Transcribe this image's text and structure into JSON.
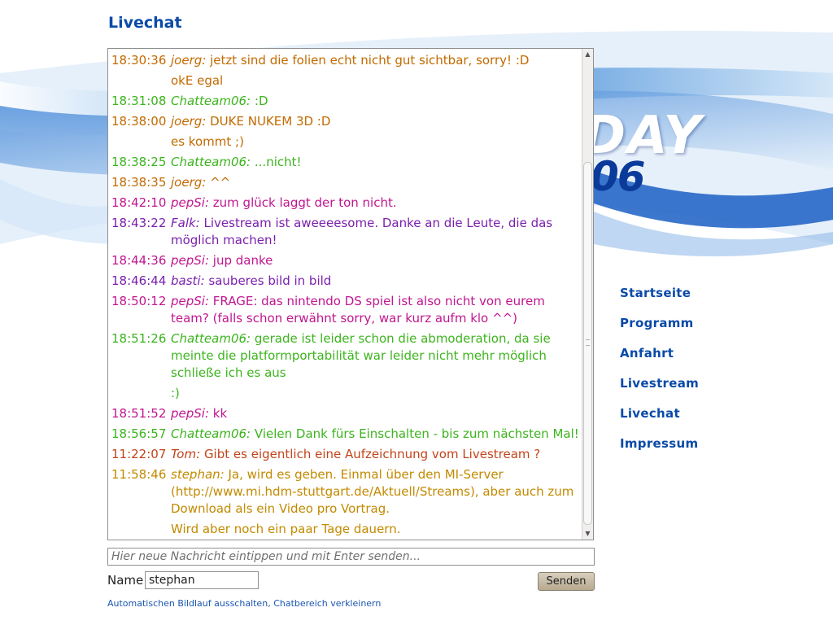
{
  "page": {
    "title": "Livechat"
  },
  "logo": {
    "text": "DAY",
    "year": "06"
  },
  "chat": {
    "messages": [
      {
        "time": "18:30:36",
        "nick": "joerg:",
        "text": "jetzt sind die folien echt nicht gut sichtbar, sorry! :D",
        "color": "#c26a00"
      },
      {
        "time": "",
        "nick": "",
        "text": "okE egal",
        "color": "#c26a00"
      },
      {
        "time": "18:31:08",
        "nick": "Chatteam06:",
        "text": ":D",
        "color": "#3cb41e"
      },
      {
        "time": "18:38:00",
        "nick": "joerg:",
        "text": "DUKE NUKEM 3D :D",
        "color": "#c26a00"
      },
      {
        "time": "",
        "nick": "",
        "text": "es kommt ;)",
        "color": "#c26a00"
      },
      {
        "time": "18:38:25",
        "nick": "Chatteam06:",
        "text": "...nicht!",
        "color": "#3cb41e"
      },
      {
        "time": "18:38:35",
        "nick": "joerg:",
        "text": "^^",
        "color": "#c26a00"
      },
      {
        "time": "18:42:10",
        "nick": "pepSi:",
        "text": "zum glück laggt der ton nicht.",
        "color": "#c0168f"
      },
      {
        "time": "18:43:22",
        "nick": "Falk:",
        "text": "Livestream ist aweeeesome. Danke an die Leute, die das möglich machen!",
        "color": "#7a1fae"
      },
      {
        "time": "18:44:36",
        "nick": "pepSi:",
        "text": "jup danke",
        "color": "#c0168f"
      },
      {
        "time": "18:46:44",
        "nick": "basti:",
        "text": "sauberes bild in bild",
        "color": "#7a1fae"
      },
      {
        "time": "18:50:12",
        "nick": "pepSi:",
        "text": "FRAGE: das nintendo DS spiel ist also nicht von eurem team? (falls schon erwähnt sorry, war kurz aufm klo ^^)",
        "color": "#c0168f"
      },
      {
        "time": "18:51:26",
        "nick": "Chatteam06:",
        "text": "gerade ist leider schon die abmoderation, da sie meinte die platformportabilität war leider nicht mehr möglich schließe ich es aus",
        "color": "#3cb41e"
      },
      {
        "time": "",
        "nick": "",
        "text": ":)",
        "color": "#3cb41e"
      },
      {
        "time": "18:51:52",
        "nick": "pepSi:",
        "text": "kk",
        "color": "#c0168f"
      },
      {
        "time": "18:56:57",
        "nick": "Chatteam06:",
        "text": "Vielen Dank fürs Einschalten - bis zum nächsten Mal!",
        "color": "#3cb41e"
      },
      {
        "time": "11:22:07",
        "nick": "Tom:",
        "text": "Gibt es eigentlich eine Aufzeichnung vom Livestream ?",
        "color": "#c2441a"
      },
      {
        "time": "11:58:46",
        "nick": "stephan:",
        "text": "Ja, wird es geben. Einmal über den MI-Server (http://www.mi.hdm-stuttgart.de/Aktuell/Streams), aber auch zum Download als ein Video pro Vortrag.",
        "color": "#c28a00"
      },
      {
        "time": "",
        "nick": "",
        "text": "Wird aber noch ein paar Tage dauern.",
        "color": "#c28a00"
      }
    ]
  },
  "composer": {
    "message_placeholder": "Hier neue Nachricht eintippen und mit Enter senden...",
    "name_label": "Name",
    "name_value": "stephan",
    "send_label": "Senden"
  },
  "options": {
    "autoscroll_label": "Automatischen Bildlauf ausschalten",
    "separator": ", ",
    "shrink_label": "Chatbereich verkleinern"
  },
  "nav": {
    "items": [
      "Startseite",
      "Programm",
      "Anfahrt",
      "Livestream",
      "Livechat",
      "Impressum"
    ]
  }
}
